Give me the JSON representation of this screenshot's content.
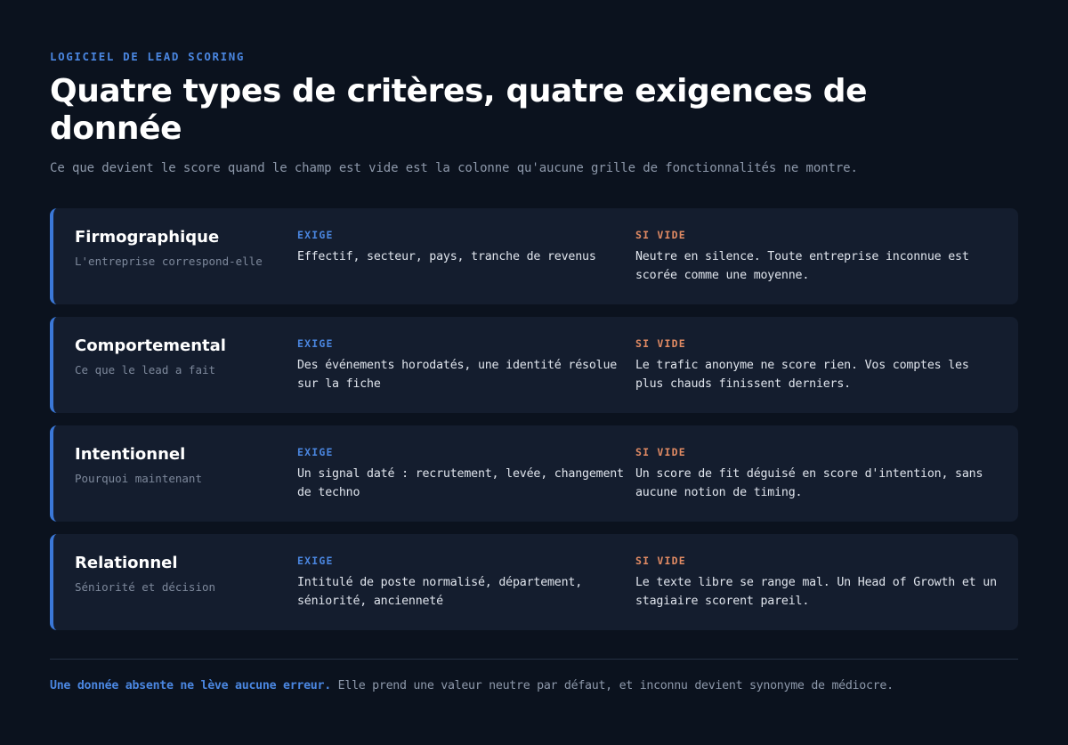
{
  "header": {
    "eyebrow": "LOGICIEL DE LEAD SCORING",
    "title": "Quatre types de critères, quatre exigences de donnée",
    "subtitle": "Ce que devient le score quand le champ est vide est la colonne qu'aucune grille de fonctionnalités ne montre."
  },
  "labels": {
    "requires": "EXIGE",
    "if_empty": "SI VIDE"
  },
  "criteria": [
    {
      "name": "Firmographique",
      "question": "L'entreprise correspond-elle",
      "requires": "Effectif, secteur, pays, tranche de revenus",
      "if_empty": "Neutre en silence. Toute entreprise inconnue est scorée comme une moyenne."
    },
    {
      "name": "Comportemental",
      "question": "Ce que le lead a fait",
      "requires": "Des événements horodatés, une identité résolue sur la fiche",
      "if_empty": "Le trafic anonyme ne score rien. Vos comptes les plus chauds finissent derniers."
    },
    {
      "name": "Intentionnel",
      "question": "Pourquoi maintenant",
      "requires": "Un signal daté : recrutement, levée, changement de techno",
      "if_empty": "Un score de fit déguisé en score d'intention, sans aucune notion de timing."
    },
    {
      "name": "Relationnel",
      "question": "Séniorité et décision",
      "requires": "Intitulé de poste normalisé, département, séniorité, ancienneté",
      "if_empty": "Le texte libre se range mal. Un Head of Growth et un stagiaire scorent pareil."
    }
  ],
  "footer": {
    "strong": "Une donnée absente ne lève aucune erreur.",
    "rest": "Elle prend une valeur neutre par défaut, et inconnu devient synonyme de médiocre."
  },
  "colors": {
    "background": "#0b121e",
    "card": "#141d2e",
    "accent_blue": "#4a86e0",
    "accent_orange": "#e08a63"
  }
}
